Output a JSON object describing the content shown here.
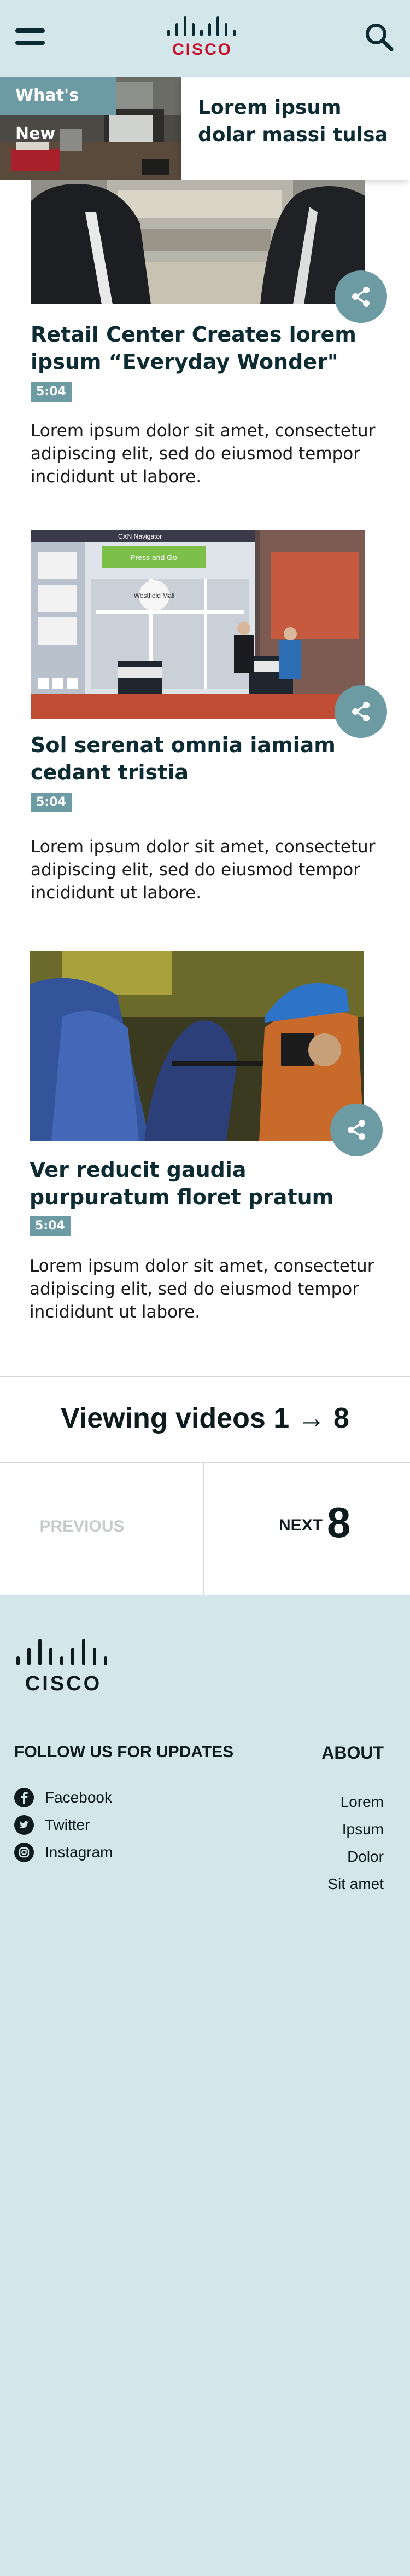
{
  "header": {
    "brand": "CISCO",
    "menu_icon": "hamburger-menu-icon",
    "search_icon": "search-icon"
  },
  "whats_new": {
    "tag": "What's New",
    "title": "Lorem ipsum dolar massi tulsa"
  },
  "videos": [
    {
      "title": "Retail Center Creates lorem ipsum “Everyday Wonder\"",
      "duration": "5:04",
      "description": "Lorem ipsum dolor sit amet, consectetur adipiscing elit, sed do eiusmod tempor incididunt ut labore.",
      "share_icon": "share-icon"
    },
    {
      "title": "Sol serenat omnia iamiam cedant tristia",
      "duration": "5:04",
      "description": "Lorem ipsum dolor sit amet, consectetur adipiscing elit, sed do eiusmod tempor incididunt ut labore.",
      "share_icon": "share-icon",
      "screen_labels": {
        "top": "CXN Navigator",
        "place": "Westfield Mall",
        "button": "Press and Go"
      }
    },
    {
      "title": "Ver reducit gaudia purpuratum floret pratum",
      "duration": "5:04",
      "description": "Lorem ipsum dolor sit amet, consectetur adipiscing elit, sed do eiusmod tempor incididunt ut labore.",
      "share_icon": "share-icon"
    }
  ],
  "pagination": {
    "viewing": "Viewing videos 1 → 8",
    "previous": "PREVIOUS",
    "next_label": "NEXT",
    "next_number": "8"
  },
  "footer": {
    "brand": "CISCO",
    "follow_title": "FOLLOW US FOR UPDATES",
    "social": [
      {
        "label": "Facebook",
        "icon": "facebook-icon"
      },
      {
        "label": "Twitter",
        "icon": "twitter-icon"
      },
      {
        "label": "Instagram",
        "icon": "instagram-icon"
      }
    ],
    "about_title": "ABOUT",
    "about_links": [
      "Lorem",
      "Ipsum",
      "Dolor",
      "Sit amet"
    ]
  },
  "colors": {
    "header_bg": "#d3e6ea",
    "accent": "#6c9ba3",
    "dark_text": "#0d2b33",
    "cisco_red": "#c8102e"
  }
}
